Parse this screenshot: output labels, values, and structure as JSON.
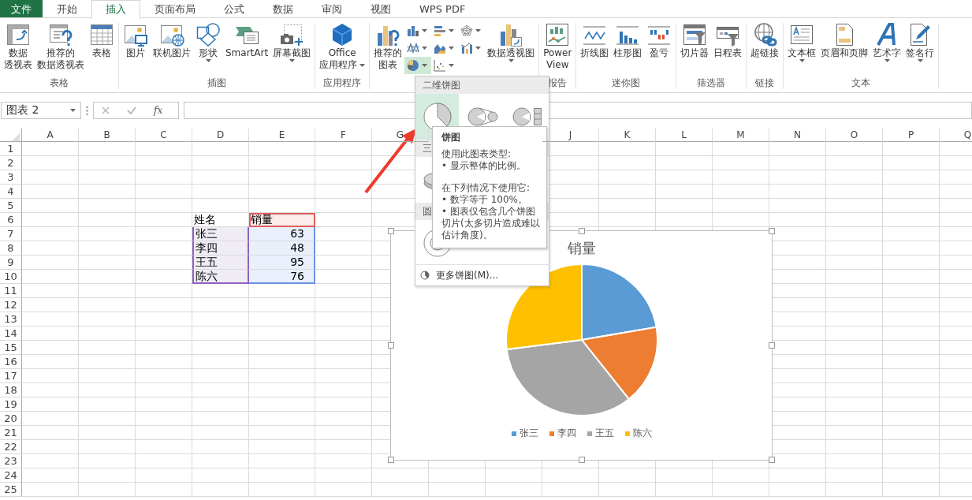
{
  "tabs": [
    {
      "label": "文件",
      "kind": "file",
      "selected": false
    },
    {
      "label": "开始",
      "kind": "tab",
      "selected": false
    },
    {
      "label": "插入",
      "kind": "tab",
      "selected": true
    },
    {
      "label": "页面布局",
      "kind": "tab",
      "selected": false
    },
    {
      "label": "公式",
      "kind": "tab",
      "selected": false
    },
    {
      "label": "数据",
      "kind": "tab",
      "selected": false
    },
    {
      "label": "审阅",
      "kind": "tab",
      "selected": false
    },
    {
      "label": "视图",
      "kind": "tab",
      "selected": false
    },
    {
      "label": "WPS PDF",
      "kind": "tab",
      "selected": false
    }
  ],
  "ribbon": [
    {
      "label": "表格",
      "items": [
        {
          "kind": "large",
          "lines": [
            "数据",
            "透视表"
          ],
          "dropdown": false
        },
        {
          "kind": "large",
          "lines": [
            "推荐的",
            "数据透视表"
          ],
          "dropdown": false
        },
        {
          "kind": "large",
          "lines": [
            "表格"
          ],
          "dropdown": false
        }
      ]
    },
    {
      "label": "插图",
      "items": [
        {
          "kind": "large",
          "lines": [
            "图片"
          ],
          "dropdown": false
        },
        {
          "kind": "large",
          "lines": [
            "联机图片"
          ],
          "dropdown": false
        },
        {
          "kind": "large",
          "lines": [
            "形状"
          ],
          "dropdown": true
        },
        {
          "kind": "large",
          "lines": [
            "SmartArt"
          ],
          "dropdown": false
        },
        {
          "kind": "large",
          "lines": [
            "屏幕截图"
          ],
          "dropdown": true
        }
      ]
    },
    {
      "label": "应用程序",
      "items": [
        {
          "kind": "large",
          "lines": [
            "Office",
            "应用程序"
          ],
          "dropdown": true
        }
      ]
    },
    {
      "items": [
        {
          "kind": "large",
          "lines": [
            "推荐的",
            "图表"
          ],
          "dropdown": false
        },
        {
          "kind": "chart-types",
          "options": [
            {
              "selected": false
            },
            {
              "selected": false
            },
            {
              "selected": false
            },
            {
              "selected": false
            },
            {
              "selected": false
            },
            {
              "selected": false
            },
            {
              "selected": true
            },
            {
              "selected": false
            }
          ]
        },
        {
          "kind": "large",
          "lines": [
            "数据透视图"
          ],
          "dropdown": true
        }
      ]
    },
    {
      "label": "报告",
      "items": [
        {
          "kind": "large",
          "lines": [
            "Power",
            "View"
          ],
          "dropdown": false
        }
      ]
    },
    {
      "label": "迷你图",
      "items": [
        {
          "kind": "large",
          "lines": [
            "折线图"
          ],
          "dropdown": false
        },
        {
          "kind": "large",
          "lines": [
            "柱形图"
          ],
          "dropdown": false
        },
        {
          "kind": "large",
          "lines": [
            "盈亏"
          ],
          "dropdown": false
        }
      ]
    },
    {
      "label": "筛选器",
      "items": [
        {
          "kind": "large",
          "lines": [
            "切片器"
          ],
          "dropdown": false
        },
        {
          "kind": "large",
          "lines": [
            "日程表"
          ],
          "dropdown": false
        }
      ]
    },
    {
      "label": "链接",
      "items": [
        {
          "kind": "large",
          "lines": [
            "超链接"
          ],
          "dropdown": false
        }
      ]
    },
    {
      "label": "文本",
      "items": [
        {
          "kind": "large",
          "lines": [
            "文本框"
          ],
          "dropdown": true
        },
        {
          "kind": "large",
          "lines": [
            "页眉和页脚"
          ],
          "dropdown": false
        },
        {
          "kind": "large",
          "lines": [
            "艺术字"
          ],
          "dropdown": true
        },
        {
          "kind": "large",
          "lines": [
            "签名行"
          ],
          "dropdown": true
        }
      ]
    }
  ],
  "formula_bar": {
    "name_box": "图表 2",
    "function_button": "fx"
  },
  "sheet": {
    "columns": [
      "A",
      "B",
      "C",
      "D",
      "E",
      "F",
      "G",
      null,
      null,
      "J",
      "K",
      "L",
      "M",
      "N",
      "O",
      "P",
      "Q"
    ],
    "rows": [
      "1",
      "2",
      "3",
      "4",
      "5",
      "6",
      "7",
      "8",
      "9",
      "10",
      "11",
      "12",
      "13",
      "14",
      "15",
      "16",
      "17",
      "18",
      "19",
      "20",
      "21",
      "22",
      "23",
      "24",
      "25"
    ],
    "range": {
      "header": [
        "姓名",
        "销量"
      ],
      "records": [
        {
          "name": "张三",
          "value": "63"
        },
        {
          "name": "李四",
          "value": "48"
        },
        {
          "name": "王五",
          "value": "95"
        },
        {
          "name": "陈六",
          "value": "76"
        }
      ]
    }
  },
  "chart": {
    "chart_data": {
      "type": "pie",
      "title": "销量",
      "categories": [
        "张三",
        "李四",
        "王五",
        "陈六"
      ],
      "values": [
        22.3,
        17.0,
        33.7,
        27.0
      ]
    },
    "legend": [
      {
        "color": "#5b9bd5"
      },
      {
        "color": "#ed7d31"
      },
      {
        "color": "#a5a5a5"
      },
      {
        "color": "#ffc000"
      }
    ]
  },
  "pie_menu": {
    "sections": [
      {
        "header": "二维饼图",
        "options": [
          {
            "selected": true
          },
          {
            "selected": false
          },
          {
            "selected": false
          }
        ]
      },
      {
        "header": "三",
        "options": [
          {
            "selected": false
          }
        ]
      },
      {
        "header": "圆",
        "options": [
          {
            "selected": false
          }
        ]
      }
    ],
    "footer": "更多饼图(M)..."
  },
  "tooltip": {
    "title": "饼图",
    "paragraphs": [
      [
        "使用此图表类型:",
        "• 显示整体的比例。"
      ],
      [
        "在下列情况下使用它:",
        "• 数字等于 100%。",
        "• 图表仅包含几个饼图切片(太多切片造成难以估计角度)。"
      ]
    ]
  }
}
